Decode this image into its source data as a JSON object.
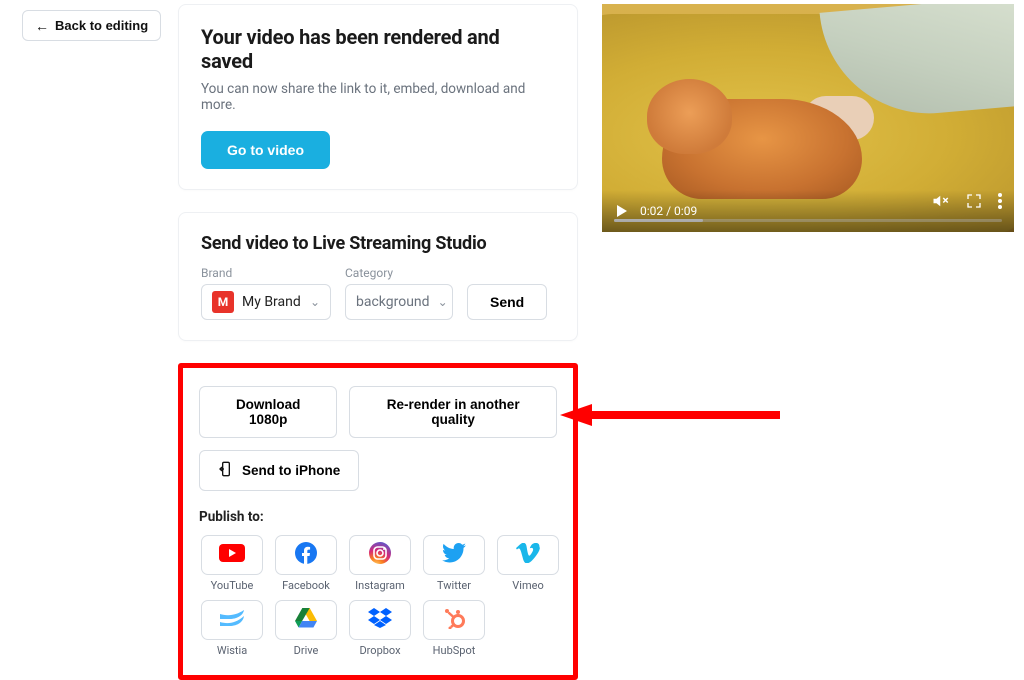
{
  "back_button": "Back to editing",
  "rendered": {
    "title": "Your video has been rendered and saved",
    "subtitle": "You can now share the link to it, embed, download and more.",
    "go_button": "Go to video"
  },
  "streaming": {
    "title": "Send video to Live Streaming Studio",
    "brand_label": "Brand",
    "brand_badge": "M",
    "brand_value": "My Brand",
    "category_label": "Category",
    "category_value": "background",
    "send_button": "Send"
  },
  "download_panel": {
    "download_button": "Download 1080p",
    "rerender_button": "Re-render in another quality",
    "send_iphone_button": "Send to iPhone",
    "publish_label": "Publish to:",
    "targets": [
      {
        "label": "YouTube"
      },
      {
        "label": "Facebook"
      },
      {
        "label": "Instagram"
      },
      {
        "label": "Twitter"
      },
      {
        "label": "Vimeo"
      },
      {
        "label": "Wistia"
      },
      {
        "label": "Drive"
      },
      {
        "label": "Dropbox"
      },
      {
        "label": "HubSpot"
      }
    ]
  },
  "video": {
    "time": "0:02 / 0:09"
  }
}
